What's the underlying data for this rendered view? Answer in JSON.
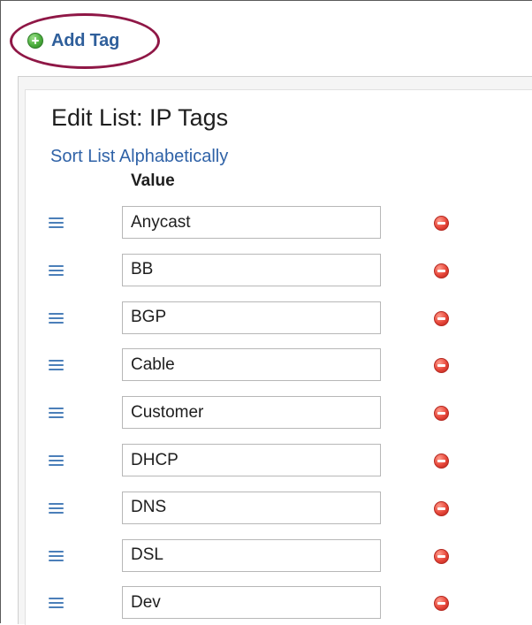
{
  "toolbar": {
    "add_tag_label": "Add Tag",
    "add_tag_icon": "plus-circle-icon",
    "highlight_color": "#8f1746"
  },
  "panel": {
    "title": "Edit List: IP Tags",
    "sort_link": "Sort List Alphabetically",
    "column_header": "Value"
  },
  "rows": [
    {
      "value": "Anycast"
    },
    {
      "value": "BB"
    },
    {
      "value": "BGP"
    },
    {
      "value": "Cable"
    },
    {
      "value": "Customer"
    },
    {
      "value": "DHCP"
    },
    {
      "value": "DNS"
    },
    {
      "value": "DSL"
    },
    {
      "value": "Dev"
    }
  ],
  "icons": {
    "drag_handle": "drag-handle-icon",
    "remove": "remove-circle-icon"
  },
  "colors": {
    "link": "#2f62a7",
    "add_icon": "#4cae3e",
    "remove_icon": "#e7473a",
    "drag_handle": "#4b7fb9"
  }
}
